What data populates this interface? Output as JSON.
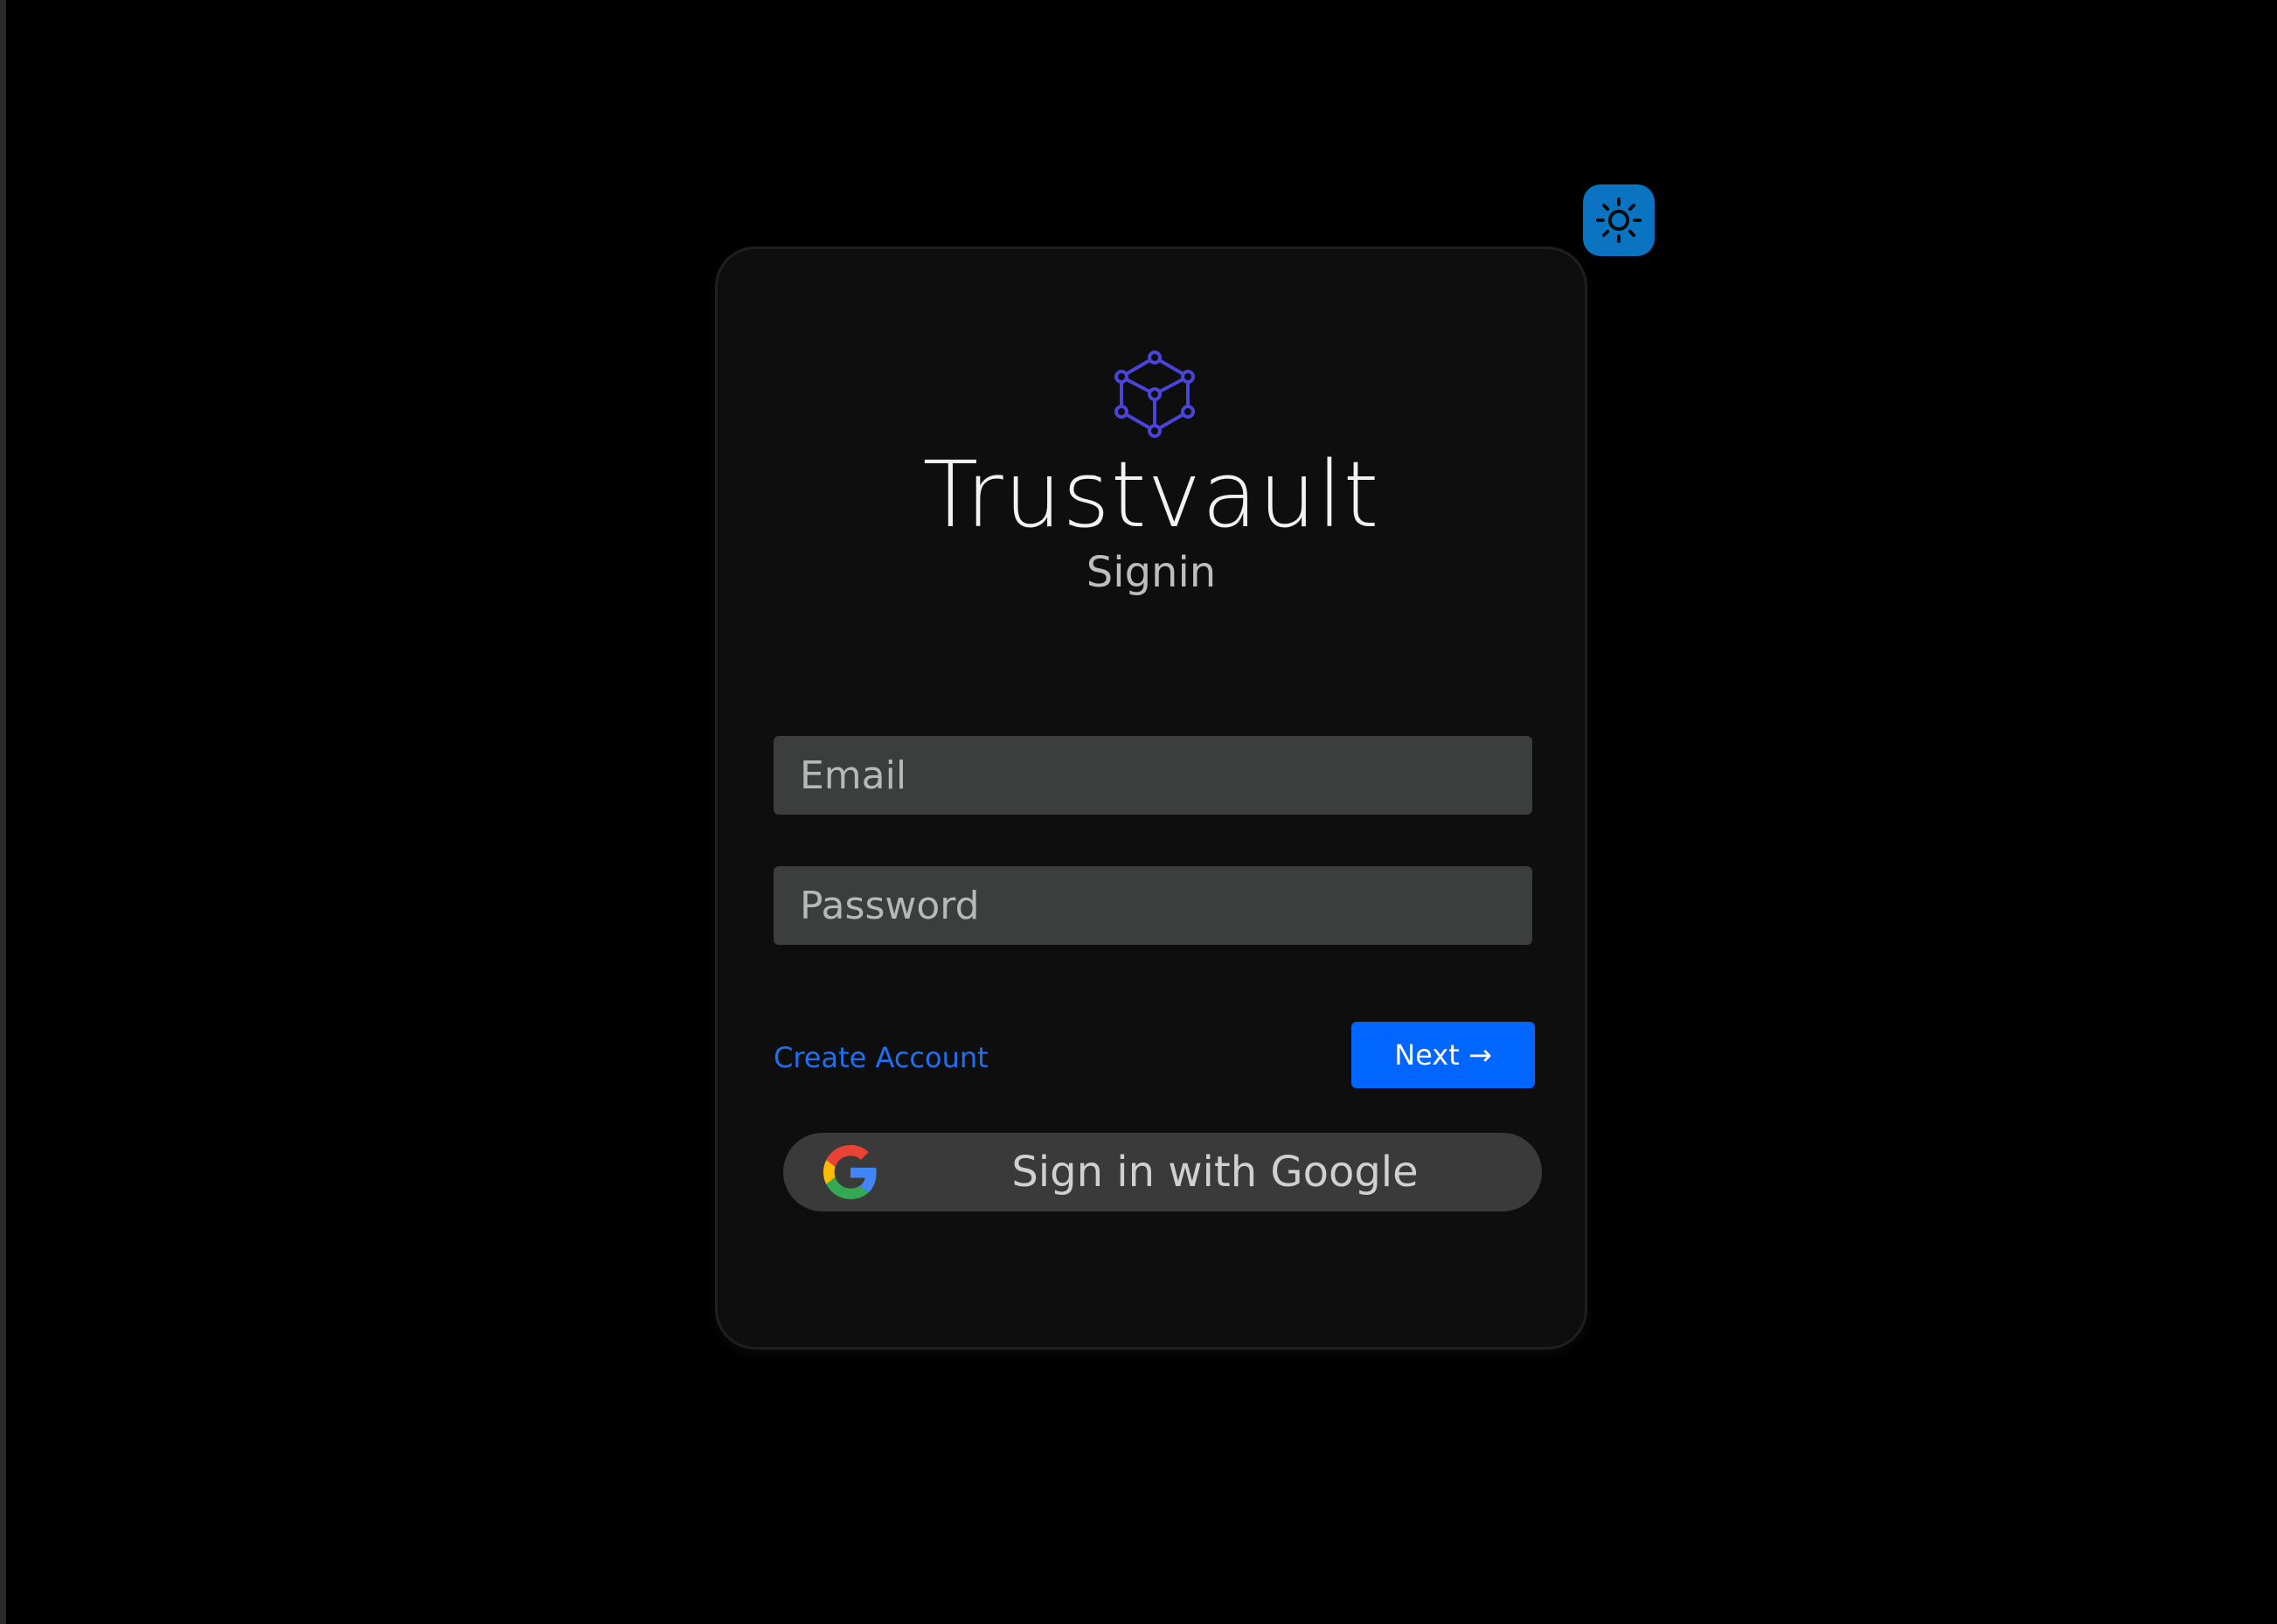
{
  "theme_toggle": {
    "icon": "sun-icon",
    "color": "#0a73c2"
  },
  "brand": {
    "logo": "cube-network-icon",
    "logo_color": "#4a44d8",
    "name": "Trustvault"
  },
  "subtitle": "Signin",
  "form": {
    "email": {
      "placeholder": "Email",
      "value": ""
    },
    "password": {
      "placeholder": "Password",
      "value": ""
    }
  },
  "actions": {
    "create_account": "Create Account",
    "next": "Next →",
    "accent_color": "#0066ff"
  },
  "google": {
    "icon": "google-icon",
    "label": "Sign in with Google"
  }
}
